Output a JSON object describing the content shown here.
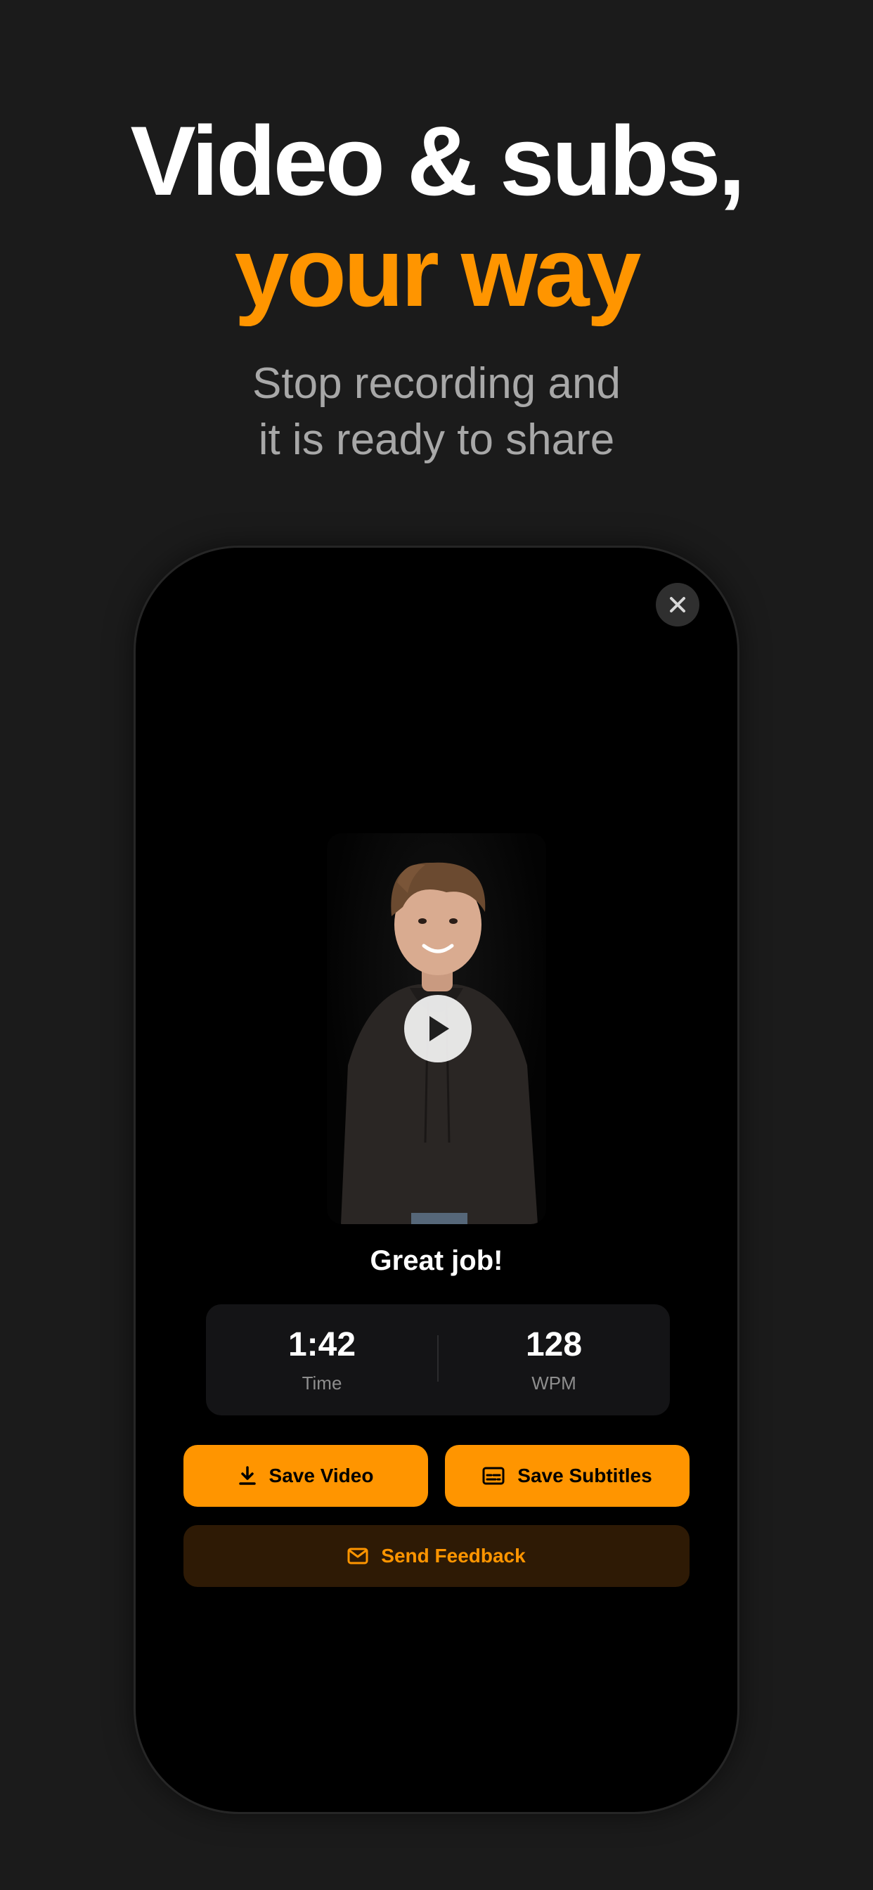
{
  "hero": {
    "title_line1": "Video & subs,",
    "title_line2": "your way",
    "subtitle_line1": "Stop recording and",
    "subtitle_line2": "it is ready to share"
  },
  "result": {
    "heading": "Great job!",
    "stats": [
      {
        "value": "1:42",
        "label": "Time"
      },
      {
        "value": "128",
        "label": "WPM"
      }
    ]
  },
  "actions": {
    "save_video": "Save Video",
    "save_subtitles": "Save Subtitles",
    "send_feedback": "Send Feedback"
  },
  "icons": {
    "close": "close-icon",
    "play": "play-icon",
    "download": "download-icon",
    "subtitles": "subtitles-icon",
    "mail": "mail-icon"
  },
  "colors": {
    "accent": "#ff9500",
    "background": "#1b1b1b",
    "feedback_bg": "#2e1a05"
  }
}
